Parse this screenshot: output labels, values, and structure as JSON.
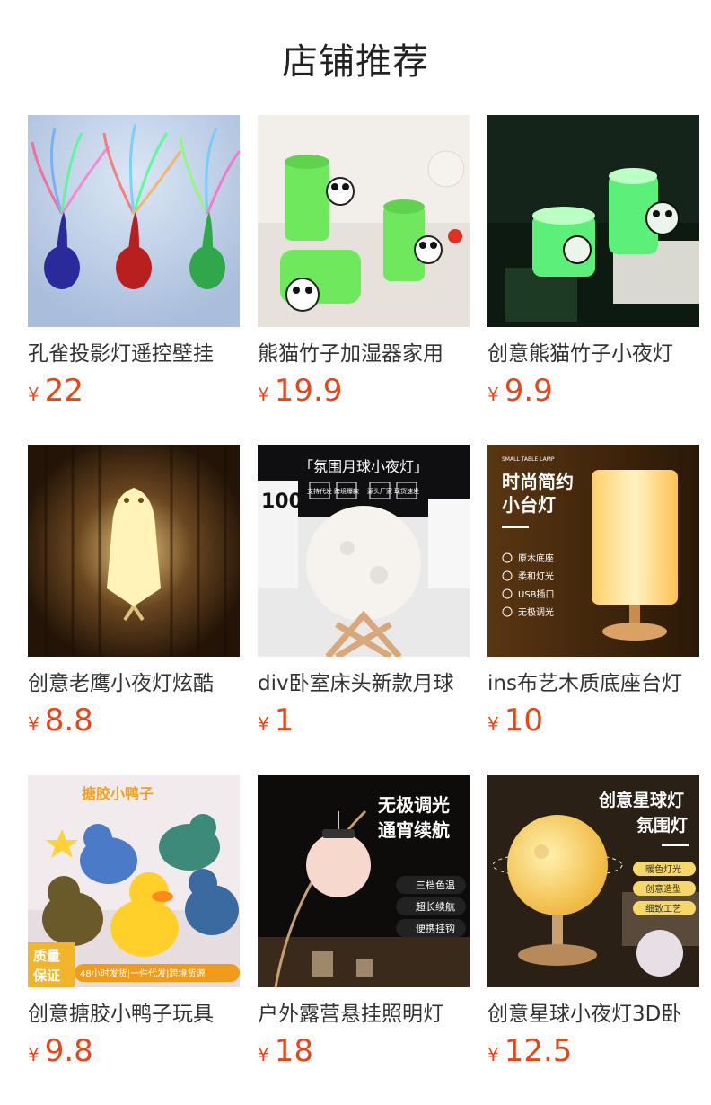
{
  "header": {
    "title": "店铺推荐"
  },
  "currency": "¥",
  "products": [
    {
      "name": "孔雀投影灯遥控壁挂",
      "price": "22",
      "image": "peacock-projection-lamps"
    },
    {
      "name": "熊猫竹子加湿器家用",
      "price": "19.9",
      "image": "panda-bamboo-humidifier"
    },
    {
      "name": "创意熊猫竹子小夜灯",
      "price": "9.9",
      "image": "glowing-panda-bamboo-lamp"
    },
    {
      "name": "创意老鹰小夜灯炫酷",
      "price": "8.8",
      "image": "eagle-wall-lamp"
    },
    {
      "name": "div卧室床头新款月球",
      "price": "1",
      "image": "moon-lamp-on-stand",
      "image_text": {
        "banner": "「氛围月球小夜灯」",
        "tags": [
          "支持代发",
          "跨境爆款",
          "源头厂家",
          "现货速发"
        ],
        "side": "100"
      }
    },
    {
      "name": "ins布艺木质底座台灯",
      "price": "10",
      "image": "fabric-table-lamp",
      "image_text": {
        "small": "SMALL TABLE LAMP",
        "headline1": "时尚简约",
        "headline2": "小台灯",
        "features": [
          "原木底座",
          "柔和灯光",
          "USB插口",
          "无极调光"
        ]
      }
    },
    {
      "name": "创意搪胶小鸭子玩具",
      "price": "9.8",
      "image": "vinyl-ducks",
      "image_text": {
        "top": "搪胶小鸭子",
        "badge1": "质量",
        "badge2": "保证",
        "banner": "48小时发货|一件代发|跨境货源"
      }
    },
    {
      "name": "户外露营悬挂照明灯",
      "price": "18",
      "image": "camping-hanging-lamp",
      "image_text": {
        "headline1": "无极调光",
        "headline2": "通宵续航",
        "features": [
          "三档色温",
          "超长续航",
          "便携挂钩"
        ]
      }
    },
    {
      "name": "创意星球小夜灯3D卧",
      "price": "12.5",
      "image": "planet-night-lamp",
      "image_text": {
        "headline1": "创意星球灯",
        "headline2": "氛围灯",
        "features": [
          "暖色灯光",
          "创意造型",
          "细致工艺"
        ]
      }
    }
  ]
}
